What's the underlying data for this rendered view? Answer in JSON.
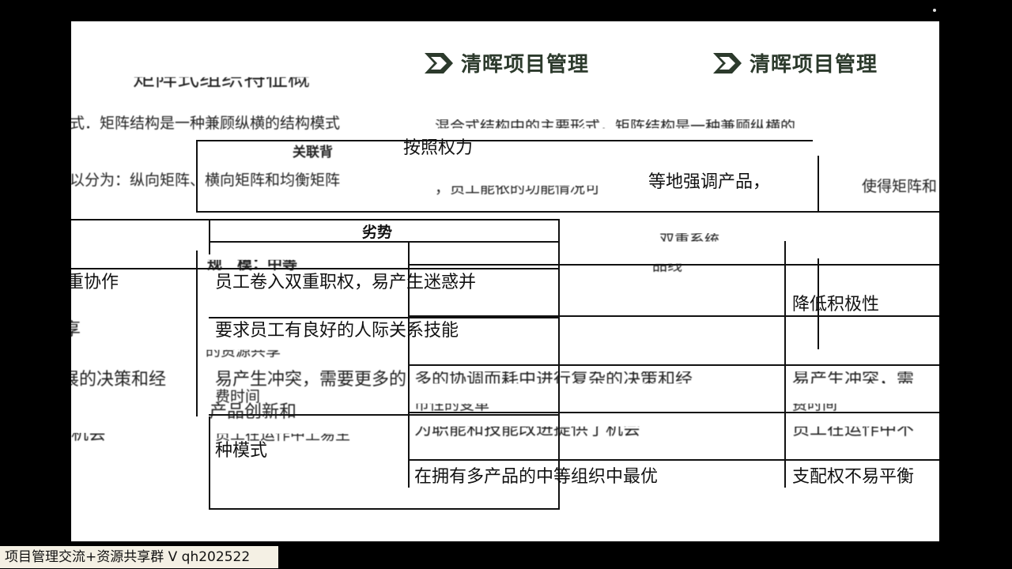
{
  "logos": [
    {
      "text": "清晖项目管理"
    },
    {
      "text": "清晖项目管理"
    }
  ],
  "fragments": {
    "title": "矩阵式组织特征概",
    "intro_line": "式．矩阵结构是一种兼顾纵横的结构模式",
    "intro_line_right": "混合式结构中的主要形式，矩阵结构是一种兼顾纵横的",
    "by_power": "按照权力",
    "divide_line": "以分为：纵向矩阵、横向矩阵和均衡矩阵",
    "divide_line_right": "，员工能依的功能情况可",
    "emphasize": "等地强调产品，",
    "emphasize_tail": "使得矩阵和",
    "related_header": "关联背",
    "disadvantage_header": "劣势",
    "scale_label": "规　模：中等",
    "dual_system": "、双重系统",
    "products": "品线",
    "collab": "重协作",
    "dual_power": "员工卷入双重职权，易产生迷惑并",
    "reduce_motivation": "降低积极性",
    "ku": "享",
    "interpersonal": "要求员工有良好的人际关系技能",
    "ai_frag": "艾",
    "shared_resource": "的资源共享",
    "decision_frag": "展的决策和经",
    "conflict_frag": "易产生冲突，需要更多的",
    "time_cost": "费时间",
    "coordinate_frag": "多的协调而耗中进行复杂的决策和经",
    "conflict_right": "易产生冲突，需",
    "product_innovation": "产品创新和",
    "skill_frag": "市性的变革",
    "time_right": "费时间",
    "opportunity": "为职能和技能改进提供了机会",
    "staff_right": "员工在运作中不",
    "opp_frag": "机会",
    "staff_left": "员工在运作中上易生",
    "mode": "种模式",
    "medium_org": "在拥有多产品的中等组织中最优",
    "power_balance": "支配权不易平衡",
    "dash": "─"
  },
  "watermark": "项目管理交流+资源共享群 V qh202522"
}
